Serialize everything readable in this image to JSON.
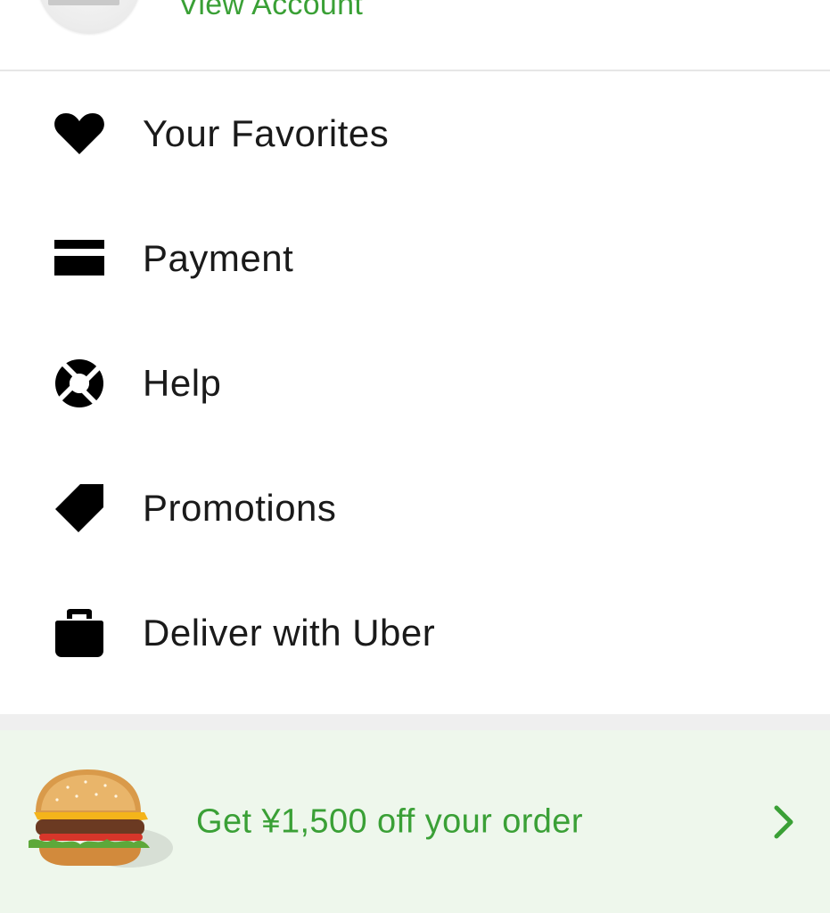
{
  "header": {
    "view_account_label": "View Account"
  },
  "menu": {
    "items": [
      {
        "label": "Your Favorites",
        "icon": "heart-icon"
      },
      {
        "label": "Payment",
        "icon": "credit-card-icon"
      },
      {
        "label": "Help",
        "icon": "lifebuoy-icon"
      },
      {
        "label": "Promotions",
        "icon": "tag-icon"
      },
      {
        "label": "Deliver with Uber",
        "icon": "delivery-bag-icon"
      }
    ]
  },
  "promo": {
    "text": "Get ¥1,500 off your order",
    "image": "burger-image",
    "chevron_icon": "chevron-right-icon"
  },
  "colors": {
    "accent_green": "#3aa036",
    "promo_background": "#eef7ec",
    "text_primary": "#1a1a1a",
    "divider": "#efefef"
  }
}
